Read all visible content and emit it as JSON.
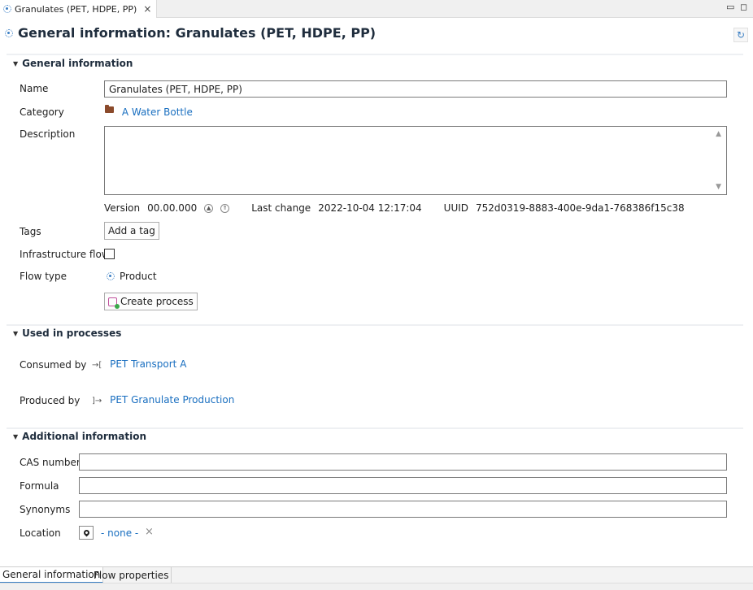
{
  "tab": {
    "label": "Granulates (PET, HDPE, PP)",
    "close": "×"
  },
  "window": {
    "minimize": "▭",
    "maximize": "◻"
  },
  "page_title": "General information: Granulates (PET, HDPE, PP)",
  "sections": {
    "general": "General information",
    "used": "Used in processes",
    "additional": "Additional information"
  },
  "general": {
    "name_label": "Name",
    "name_value": "Granulates (PET, HDPE, PP)",
    "category_label": "Category",
    "category_value": "A Water Bottle",
    "description_label": "Description",
    "description_value": "",
    "version_label": "Version",
    "version_value": "00.00.000",
    "last_change_label": "Last change",
    "last_change_value": "2022-10-04 12:17:04",
    "uuid_label": "UUID",
    "uuid_value": "752d0319-8883-400e-9da1-768386f15c38",
    "tags_label": "Tags",
    "add_tag": "Add a tag",
    "infra_label": "Infrastructure flow",
    "infra_checked": false,
    "flow_type_label": "Flow type",
    "flow_type_value": "Product",
    "create_process": "Create process"
  },
  "used": {
    "consumed_label": "Consumed by",
    "consumed_value": "PET Transport A",
    "produced_label": "Produced by",
    "produced_value": "PET Granulate Production"
  },
  "additional": {
    "cas_label": "CAS number",
    "cas_value": "",
    "formula_label": "Formula",
    "formula_value": "",
    "synonyms_label": "Synonyms",
    "synonyms_value": "",
    "location_label": "Location",
    "location_value": "- none -",
    "location_clear": "×"
  },
  "bottom_tabs": [
    "General information",
    "Flow properties"
  ],
  "colors": {
    "link": "#1a6fc0",
    "accent": "#3b7fc4",
    "folder": "#8b4a2b"
  }
}
